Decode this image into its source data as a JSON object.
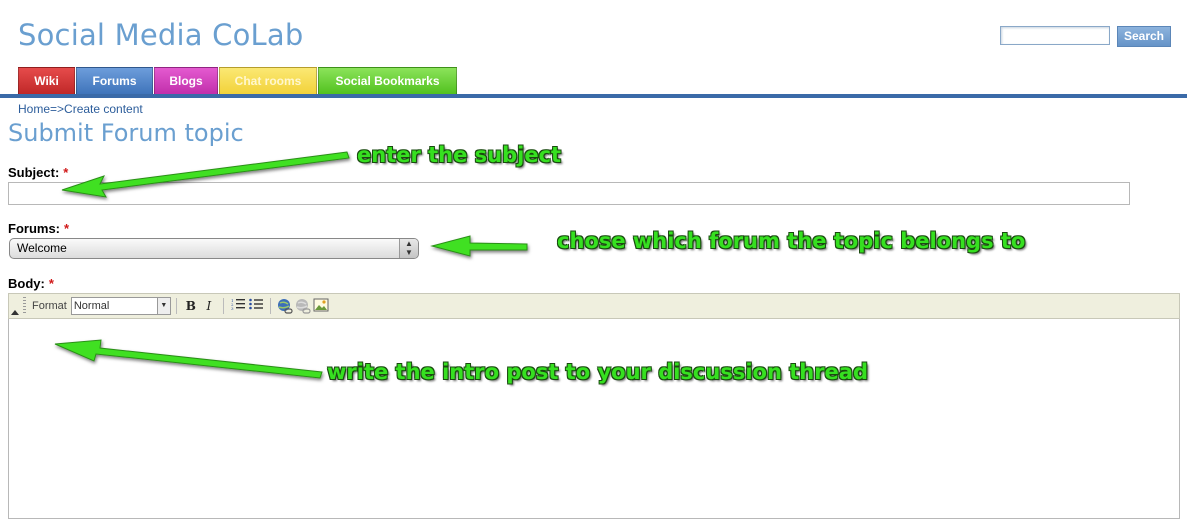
{
  "header": {
    "site_title": "Social Media CoLab",
    "search": {
      "placeholder": "",
      "button_label": "Search"
    }
  },
  "nav": {
    "tabs": [
      {
        "label": "Wiki",
        "color": "#d23434"
      },
      {
        "label": "Forums",
        "color": "#4f84c8"
      },
      {
        "label": "Blogs",
        "color": "#d23fbd"
      },
      {
        "label": "Chat rooms",
        "color": "#f7dd55"
      },
      {
        "label": "Social Bookmarks",
        "color": "#6bd23a"
      }
    ]
  },
  "breadcrumb": "Home=>Create content",
  "page_title": "Submit Forum topic",
  "form": {
    "subject_label": "Subject:",
    "forums_label": "Forums:",
    "forums_selected": "Welcome",
    "body_label": "Body:",
    "required_marker": "*",
    "editor": {
      "format_label": "Format",
      "format_selected": "Normal",
      "toolbar_icons": [
        "bold-icon",
        "italic-icon",
        "numbered-list-icon",
        "bullet-list-icon",
        "link-icon",
        "unlink-icon",
        "image-icon"
      ],
      "bold_glyph": "B",
      "italic_glyph": "I"
    }
  },
  "annotations": {
    "subject_note": "enter the subject",
    "forum_note": "chose which forum the topic belongs to",
    "body_note": "write the intro post to your discussion thread",
    "color": "#36e020"
  },
  "colors": {
    "brand": "#6a9fd0",
    "nav_bar": "#3a6aa8",
    "link": "#2c5d9b"
  }
}
